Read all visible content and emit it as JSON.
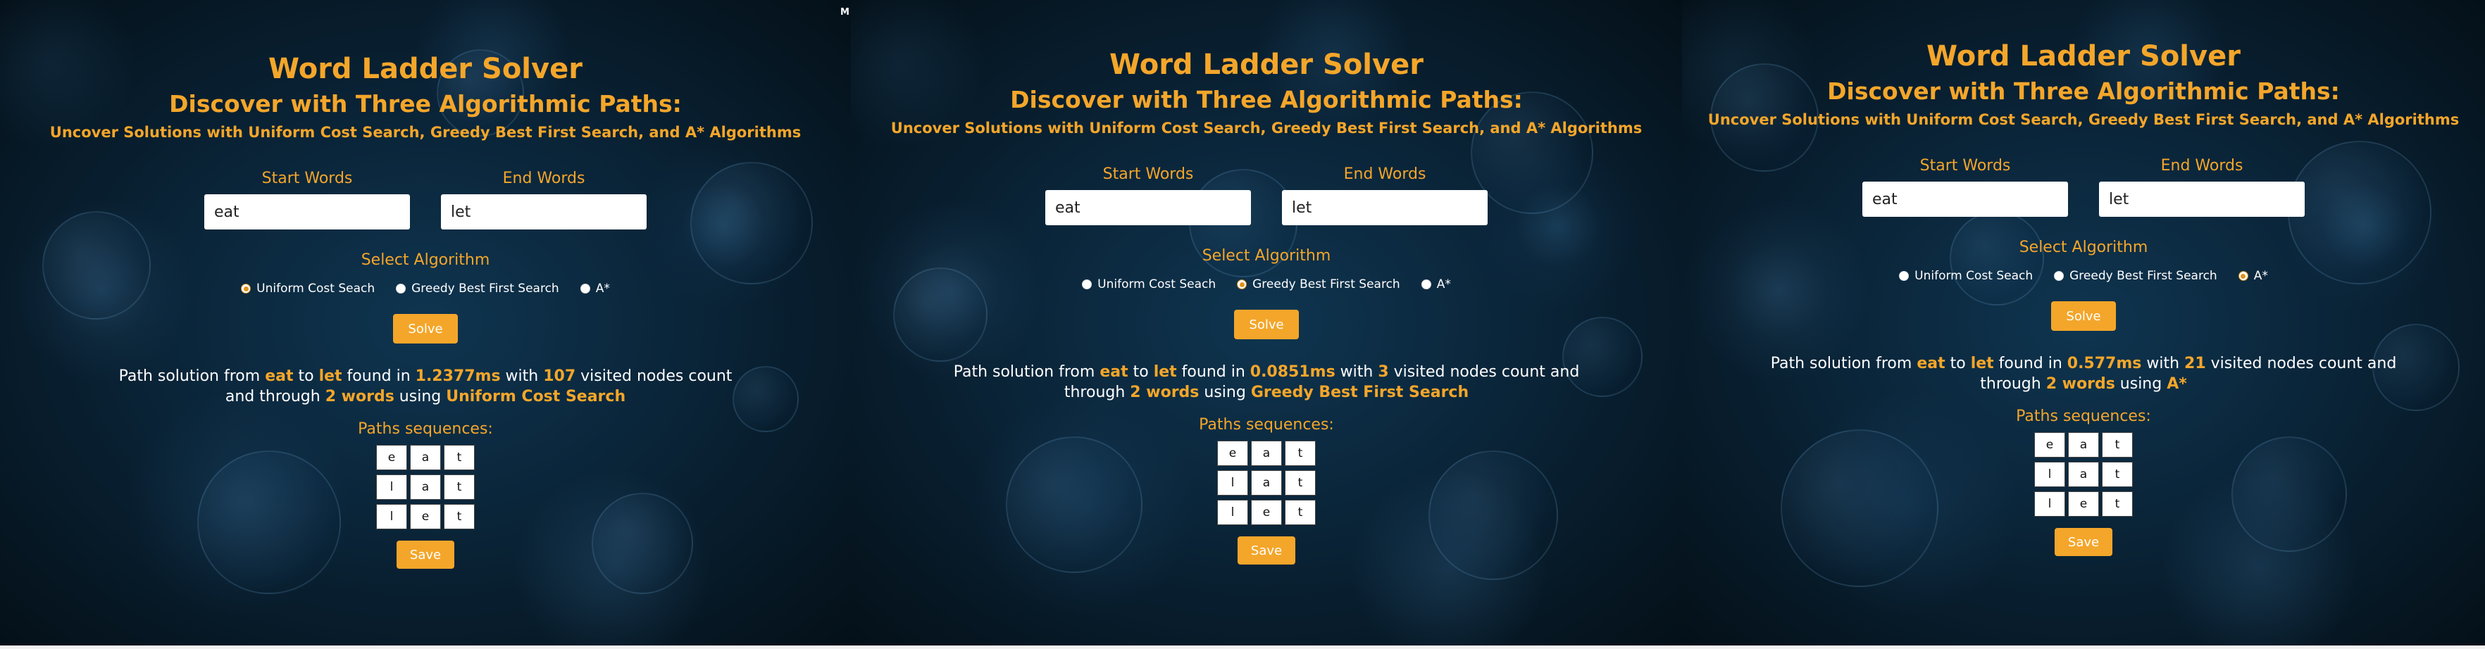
{
  "corner_mark": "M",
  "colors": {
    "accent": "#f4a62a",
    "text": "#ffffff",
    "background": "#0a2438"
  },
  "panels": [
    {
      "title": "Word Ladder Solver",
      "subtitle": "Discover with Three Algorithmic Paths:",
      "tagline": "Uncover Solutions with Uniform Cost Search, Greedy Best First Search, and A* Algorithms",
      "start_label": "Start Words",
      "start_value": "eat",
      "end_label": "End Words",
      "end_value": "let",
      "algo_label": "Select Algorithm",
      "algorithms": [
        "Uniform Cost Seach",
        "Greedy Best First Search",
        "A*"
      ],
      "selected_algorithm": "Uniform Cost Seach",
      "solve_label": "Solve",
      "result": {
        "t1": "Path solution from ",
        "start": "eat",
        "t2": " to ",
        "end": "let",
        "t3": " found in ",
        "time": "1.2377ms",
        "t4": " with ",
        "nodes": "107",
        "t5": " visited nodes count and through ",
        "words": "2 words",
        "t6": " using ",
        "algo": "Uniform Cost Search"
      },
      "seq_label": "Paths sequences:",
      "sequences": [
        [
          "e",
          "a",
          "t"
        ],
        [
          "l",
          "a",
          "t"
        ],
        [
          "l",
          "e",
          "t"
        ]
      ],
      "save_label": "Save"
    },
    {
      "title": "Word Ladder Solver",
      "subtitle": "Discover with Three Algorithmic Paths:",
      "tagline": "Uncover Solutions with Uniform Cost Search, Greedy Best First Search, and A* Algorithms",
      "start_label": "Start Words",
      "start_value": "eat",
      "end_label": "End Words",
      "end_value": "let",
      "algo_label": "Select Algorithm",
      "algorithms": [
        "Uniform Cost Seach",
        "Greedy Best First Search",
        "A*"
      ],
      "selected_algorithm": "Greedy Best First Search",
      "solve_label": "Solve",
      "result": {
        "t1": "Path solution from ",
        "start": "eat",
        "t2": " to ",
        "end": "let",
        "t3": " found in ",
        "time": "0.0851ms",
        "t4": " with ",
        "nodes": "3",
        "t5": " visited nodes count and through ",
        "words": "2 words",
        "t6": " using ",
        "algo": "Greedy Best First Search"
      },
      "seq_label": "Paths sequences:",
      "sequences": [
        [
          "e",
          "a",
          "t"
        ],
        [
          "l",
          "a",
          "t"
        ],
        [
          "l",
          "e",
          "t"
        ]
      ],
      "save_label": "Save"
    },
    {
      "title": "Word Ladder Solver",
      "subtitle": "Discover with Three Algorithmic Paths:",
      "tagline": "Uncover Solutions with Uniform Cost Search, Greedy Best First Search, and A* Algorithms",
      "start_label": "Start Words",
      "start_value": "eat",
      "end_label": "End Words",
      "end_value": "let",
      "algo_label": "Select Algorithm",
      "algorithms": [
        "Uniform Cost Seach",
        "Greedy Best First Search",
        "A*"
      ],
      "selected_algorithm": "A*",
      "solve_label": "Solve",
      "result": {
        "t1": "Path solution from ",
        "start": "eat",
        "t2": " to ",
        "end": "let",
        "t3": " found in ",
        "time": "0.577ms",
        "t4": " with ",
        "nodes": "21",
        "t5": " visited nodes count and through ",
        "words": "2 words",
        "t6": " using ",
        "algo": "A*"
      },
      "seq_label": "Paths sequences:",
      "sequences": [
        [
          "e",
          "a",
          "t"
        ],
        [
          "l",
          "a",
          "t"
        ],
        [
          "l",
          "e",
          "t"
        ]
      ],
      "save_label": "Save"
    }
  ]
}
